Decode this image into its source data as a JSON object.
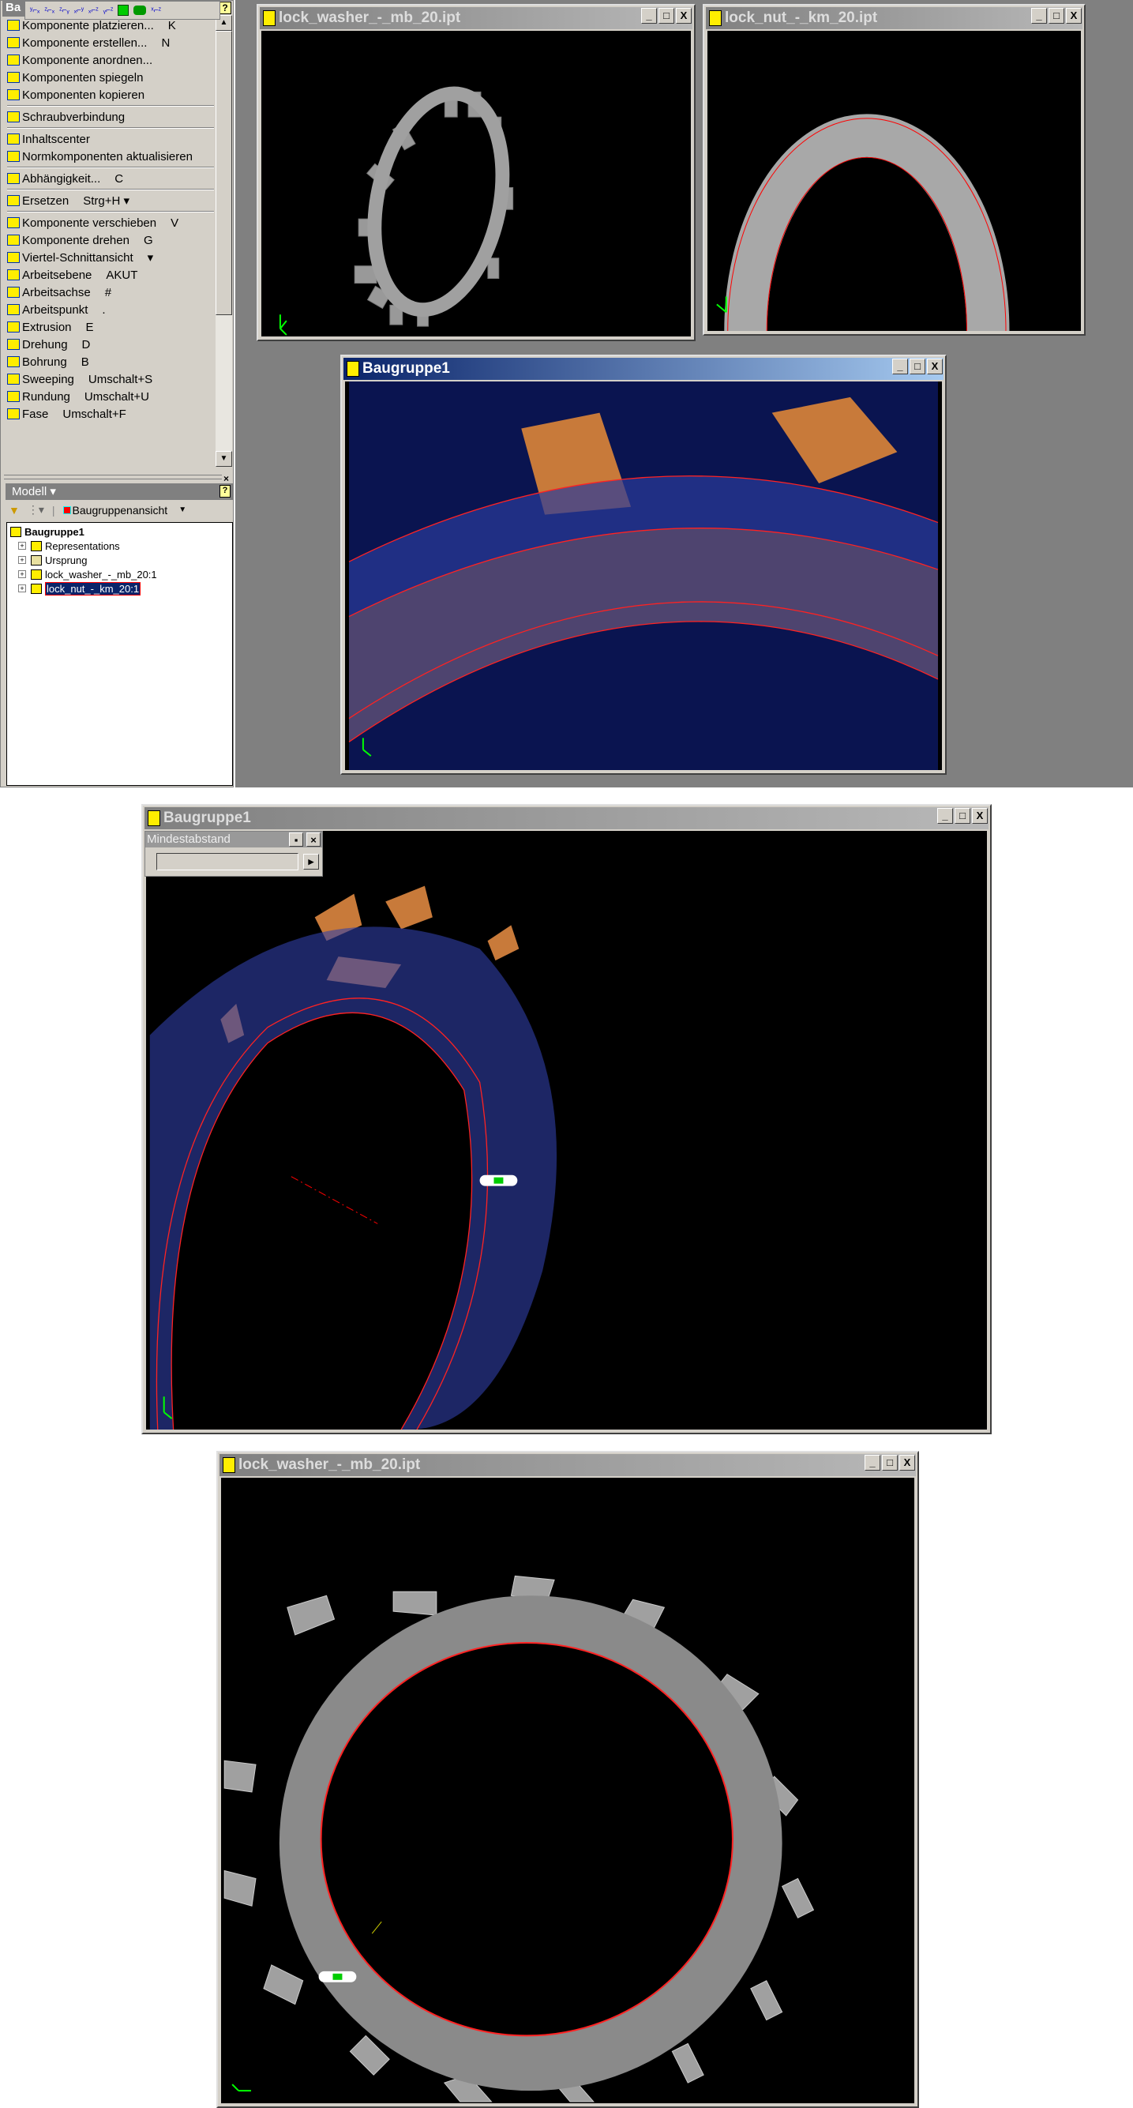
{
  "toolbar_popup": {
    "icons": [
      "view-yx-icon",
      "view-zx-icon",
      "view-zy-icon",
      "view-xy-icon",
      "view-xz-icon",
      "view-yz-icon",
      "iso-cube-icon",
      "camera-icon",
      "view-xz2-icon"
    ]
  },
  "panel_header_label": "Ba",
  "menu": {
    "items": [
      {
        "label": "Komponente platzieren...",
        "shortcut": "K"
      },
      {
        "label": "Komponente erstellen...",
        "shortcut": "N"
      },
      {
        "label": "Komponente anordnen...",
        "shortcut": ""
      },
      {
        "label": "Komponenten spiegeln",
        "shortcut": ""
      },
      {
        "label": "Komponenten kopieren",
        "shortcut": ""
      },
      {
        "label": "Schraubverbindung",
        "shortcut": ""
      },
      {
        "label": "Inhaltscenter",
        "shortcut": ""
      },
      {
        "label": "Normkomponenten aktualisieren",
        "shortcut": ""
      },
      {
        "label": "Abhängigkeit...",
        "shortcut": "C"
      },
      {
        "label": "Ersetzen",
        "shortcut": "Strg+H ▾"
      },
      {
        "label": "Komponente verschieben",
        "shortcut": "V"
      },
      {
        "label": "Komponente drehen",
        "shortcut": "G"
      },
      {
        "label": "Viertel-Schnittansicht",
        "shortcut": "▾"
      },
      {
        "label": "Arbeitsebene",
        "shortcut": "AKUT"
      },
      {
        "label": "Arbeitsachse",
        "shortcut": "#"
      },
      {
        "label": "Arbeitspunkt",
        "shortcut": "."
      },
      {
        "label": "Extrusion",
        "shortcut": "E"
      },
      {
        "label": "Drehung",
        "shortcut": "D"
      },
      {
        "label": "Bohrung",
        "shortcut": "B"
      },
      {
        "label": "Sweeping",
        "shortcut": "Umschalt+S"
      },
      {
        "label": "Rundung",
        "shortcut": "Umschalt+U"
      },
      {
        "label": "Fase",
        "shortcut": "Umschalt+F"
      }
    ]
  },
  "model": {
    "header": "Modell ▾",
    "view_select": "Baugruppenansicht",
    "tree": {
      "root": "Baugruppe1",
      "children": [
        "Representations",
        "Ursprung",
        "lock_washer_-_mb_20:1",
        "lock_nut_-_km_20:1"
      ],
      "selected": "lock_nut_-_km_20:1"
    }
  },
  "windows": {
    "washer_small": "lock_washer_-_mb_20.ipt",
    "nut_small": "lock_nut_-_km_20.ipt",
    "assembly_small": "Baugruppe1",
    "assembly_large": "Baugruppe1",
    "washer_large": "lock_washer_-_mb_20.ipt"
  },
  "min_distance": {
    "title": "Mindestabstand",
    "value": ""
  },
  "window_buttons": {
    "minimize": "_",
    "maximize": "□",
    "close": "X"
  },
  "colors": {
    "tab_orange": "#c87a3a",
    "transparent_blue": "#2a3a9a",
    "edge_red": "#ff2020",
    "steel_gray": "#9a9a9a",
    "title_active": "#0a246a"
  }
}
